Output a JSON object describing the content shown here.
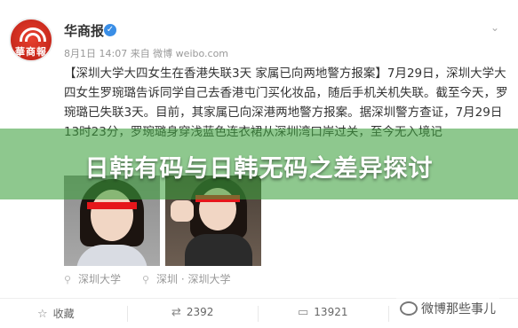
{
  "header": {
    "user_name": "华商报",
    "verified_symbol": "✓",
    "avatar_text": "華商報",
    "meta": "8月1日 14:07 来自 微博 weibo.com"
  },
  "post": {
    "text": "【深圳大学大四女生在香港失联3天 家属已向两地警方报案】7月29日，深圳大学大四女生罗琬璐告诉同学自己去香港屯门买化妆品，随后手机关机失联。截至今天，罗琬璐已失联3天。目前，其家属已向深港两地警方报案。据深圳警方查证，7月29日13时23分，罗琬璐身穿浅蓝色连衣裙从深圳湾口岸过关，至今无入境记"
  },
  "locations": [
    {
      "label": "深圳大学"
    },
    {
      "label": "深圳 · 深圳大学"
    }
  ],
  "banner": {
    "title": "日韩有码与日韩无码之差异探讨"
  },
  "footer": {
    "favorite_label": "收藏",
    "repost_count": "2392",
    "comment_count": "13921",
    "like_count": ""
  },
  "watermark": {
    "text": "微博那些事儿"
  },
  "colors": {
    "banner_overlay": "#3ca03c",
    "verify_blue": "#3a8ee6",
    "censor_red": "#e6161b"
  }
}
